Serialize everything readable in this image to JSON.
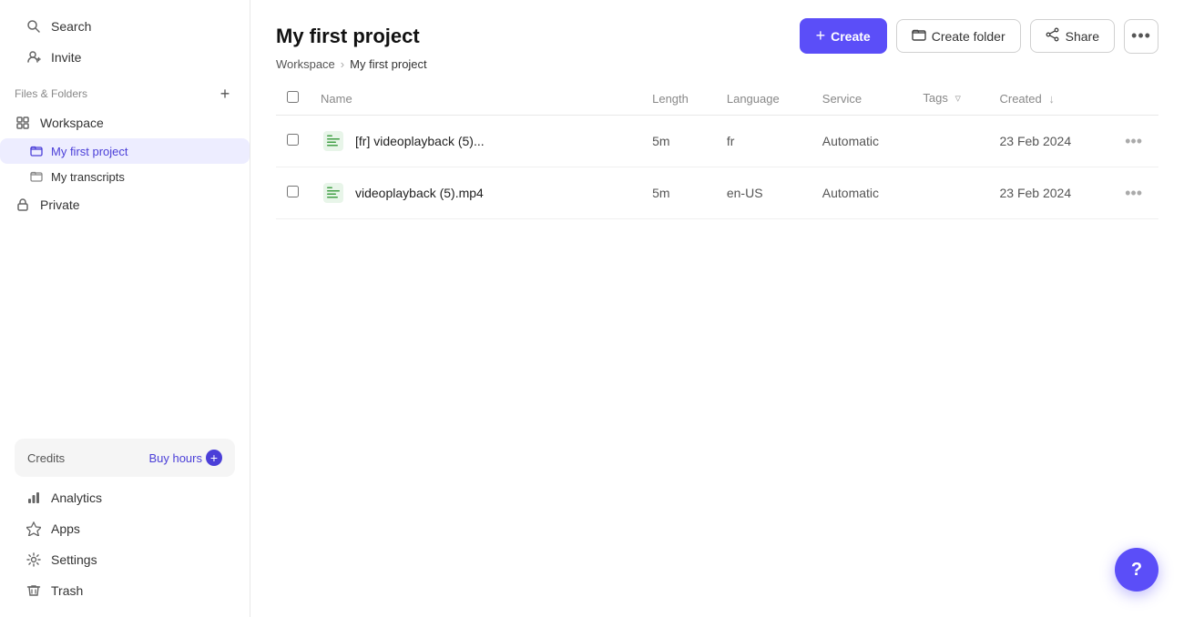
{
  "sidebar": {
    "search_label": "Search",
    "invite_label": "Invite",
    "files_folders_label": "Files & Folders",
    "workspace_label": "Workspace",
    "my_first_project_label": "My first project",
    "my_transcripts_label": "My transcripts",
    "private_label": "Private",
    "credits_label": "Credits",
    "buy_hours_label": "Buy hours",
    "analytics_label": "Analytics",
    "apps_label": "Apps",
    "settings_label": "Settings",
    "trash_label": "Trash"
  },
  "header": {
    "title": "My first project",
    "breadcrumb_workspace": "Workspace",
    "breadcrumb_project": "My first project",
    "create_label": "Create",
    "create_folder_label": "Create folder",
    "share_label": "Share"
  },
  "table": {
    "columns": {
      "name": "Name",
      "length": "Length",
      "language": "Language",
      "service": "Service",
      "tags": "Tags",
      "created": "Created"
    },
    "rows": [
      {
        "id": "row1",
        "name": "[fr] videoplayback (5)...",
        "length": "5m",
        "language": "fr",
        "service": "Automatic",
        "tags": "",
        "created": "23 Feb 2024"
      },
      {
        "id": "row2",
        "name": "videoplayback (5).mp4",
        "length": "5m",
        "language": "en-US",
        "service": "Automatic",
        "tags": "",
        "created": "23 Feb 2024"
      }
    ]
  },
  "icons": {
    "search": "🔍",
    "invite": "👤",
    "workspace": "🏠",
    "folder": "📁",
    "private": "🔒",
    "analytics": "📊",
    "apps": "⚡",
    "settings": "⚙️",
    "trash": "🗑️",
    "grid": "▦",
    "plus": "+",
    "chat": "?",
    "more": "···"
  },
  "colors": {
    "accent": "#5b4ef8",
    "active_bg": "#ededff",
    "active_text": "#4b3fd8"
  }
}
